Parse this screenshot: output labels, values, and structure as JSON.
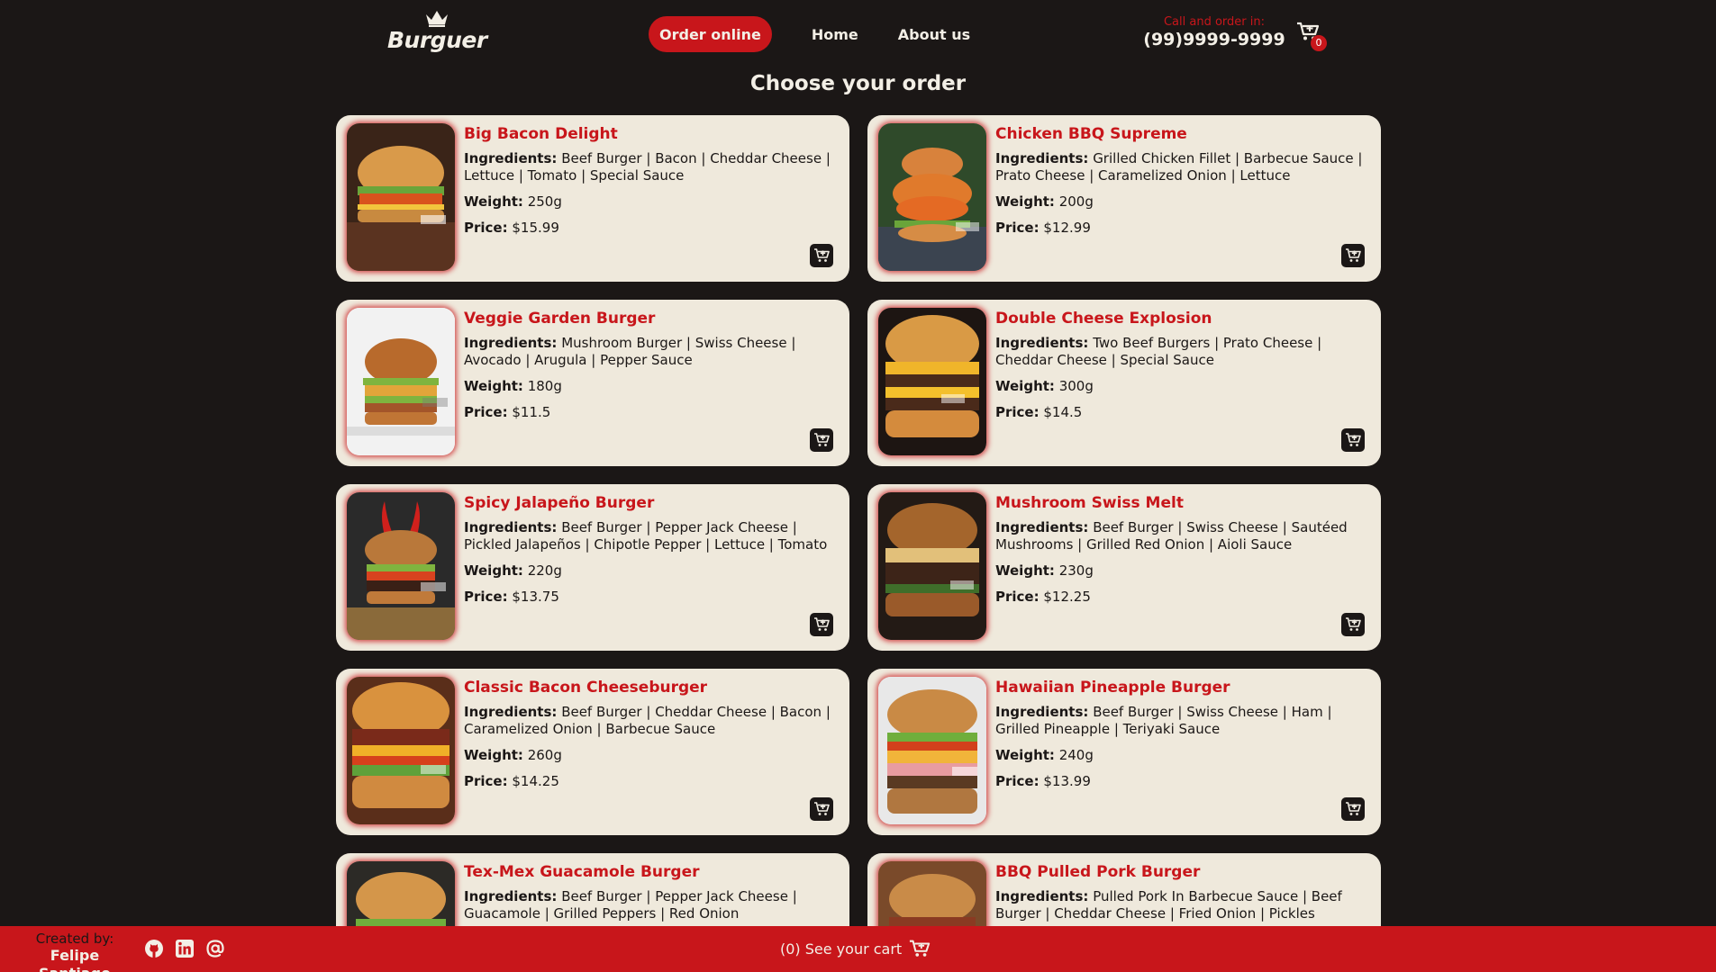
{
  "header": {
    "brand": "Burguer",
    "nav": [
      {
        "label": "Order online",
        "active": true
      },
      {
        "label": "Home",
        "active": false
      },
      {
        "label": "About us",
        "active": false
      }
    ],
    "contact_label": "Call and order in:",
    "contact_phone": "(99)9999-9999",
    "cart_count": "0"
  },
  "page_title": "Choose your order",
  "labels": {
    "ingredients": "Ingredients:",
    "weight": "Weight:",
    "price": "Price:"
  },
  "products": [
    {
      "name": "Big Bacon Delight",
      "ingredients": "Beef Burger | Bacon | Cheddar Cheese | Lettuce | Tomato | Special Sauce",
      "weight": "250g",
      "price": "$15.99"
    },
    {
      "name": "Chicken BBQ Supreme",
      "ingredients": "Grilled Chicken Fillet | Barbecue Sauce | Prato Cheese | Caramelized Onion | Lettuce",
      "weight": "200g",
      "price": "$12.99"
    },
    {
      "name": "Veggie Garden Burger",
      "ingredients": "Mushroom Burger | Swiss Cheese | Avocado | Arugula | Pepper Sauce",
      "weight": "180g",
      "price": "$11.5"
    },
    {
      "name": "Double Cheese Explosion",
      "ingredients": "Two Beef Burgers | Prato Cheese | Cheddar Cheese | Special Sauce",
      "weight": "300g",
      "price": "$14.5"
    },
    {
      "name": "Spicy Jalapeño Burger",
      "ingredients": "Beef Burger | Pepper Jack Cheese | Pickled Jalapeños | Chipotle Pepper | Lettuce | Tomato",
      "weight": "220g",
      "price": "$13.75"
    },
    {
      "name": "Mushroom Swiss Melt",
      "ingredients": "Beef Burger | Swiss Cheese | Sautéed Mushrooms | Grilled Red Onion | Aioli Sauce",
      "weight": "230g",
      "price": "$12.25"
    },
    {
      "name": "Classic Bacon Cheeseburger",
      "ingredients": "Beef Burger | Cheddar Cheese | Bacon | Caramelized Onion | Barbecue Sauce",
      "weight": "260g",
      "price": "$14.25"
    },
    {
      "name": "Hawaiian Pineapple Burger",
      "ingredients": "Beef Burger | Swiss Cheese | Ham | Grilled Pineapple | Teriyaki Sauce",
      "weight": "240g",
      "price": "$13.99"
    },
    {
      "name": "Tex-Mex Guacamole Burger",
      "ingredients": "Beef Burger | Pepper Jack Cheese | Guacamole | Grilled Peppers | Red Onion",
      "weight": "220g",
      "price": ""
    },
    {
      "name": "BBQ Pulled Pork Burger",
      "ingredients": "Pulled Pork In Barbecue Sauce | Beef Burger | Cheddar Cheese | Fried Onion | Pickles",
      "weight": "",
      "price": ""
    }
  ],
  "footer": {
    "created_by": "Created by:",
    "author": "Felipe Santiago",
    "cart_text": "(0) See your cart"
  },
  "colors": {
    "accent": "#c8161b",
    "background": "#1b1716",
    "card": "#efe9dc"
  },
  "icons": [
    "crown-icon",
    "cart-icon",
    "add-to-cart-icon",
    "github-icon",
    "linkedin-icon",
    "at-sign-icon"
  ]
}
